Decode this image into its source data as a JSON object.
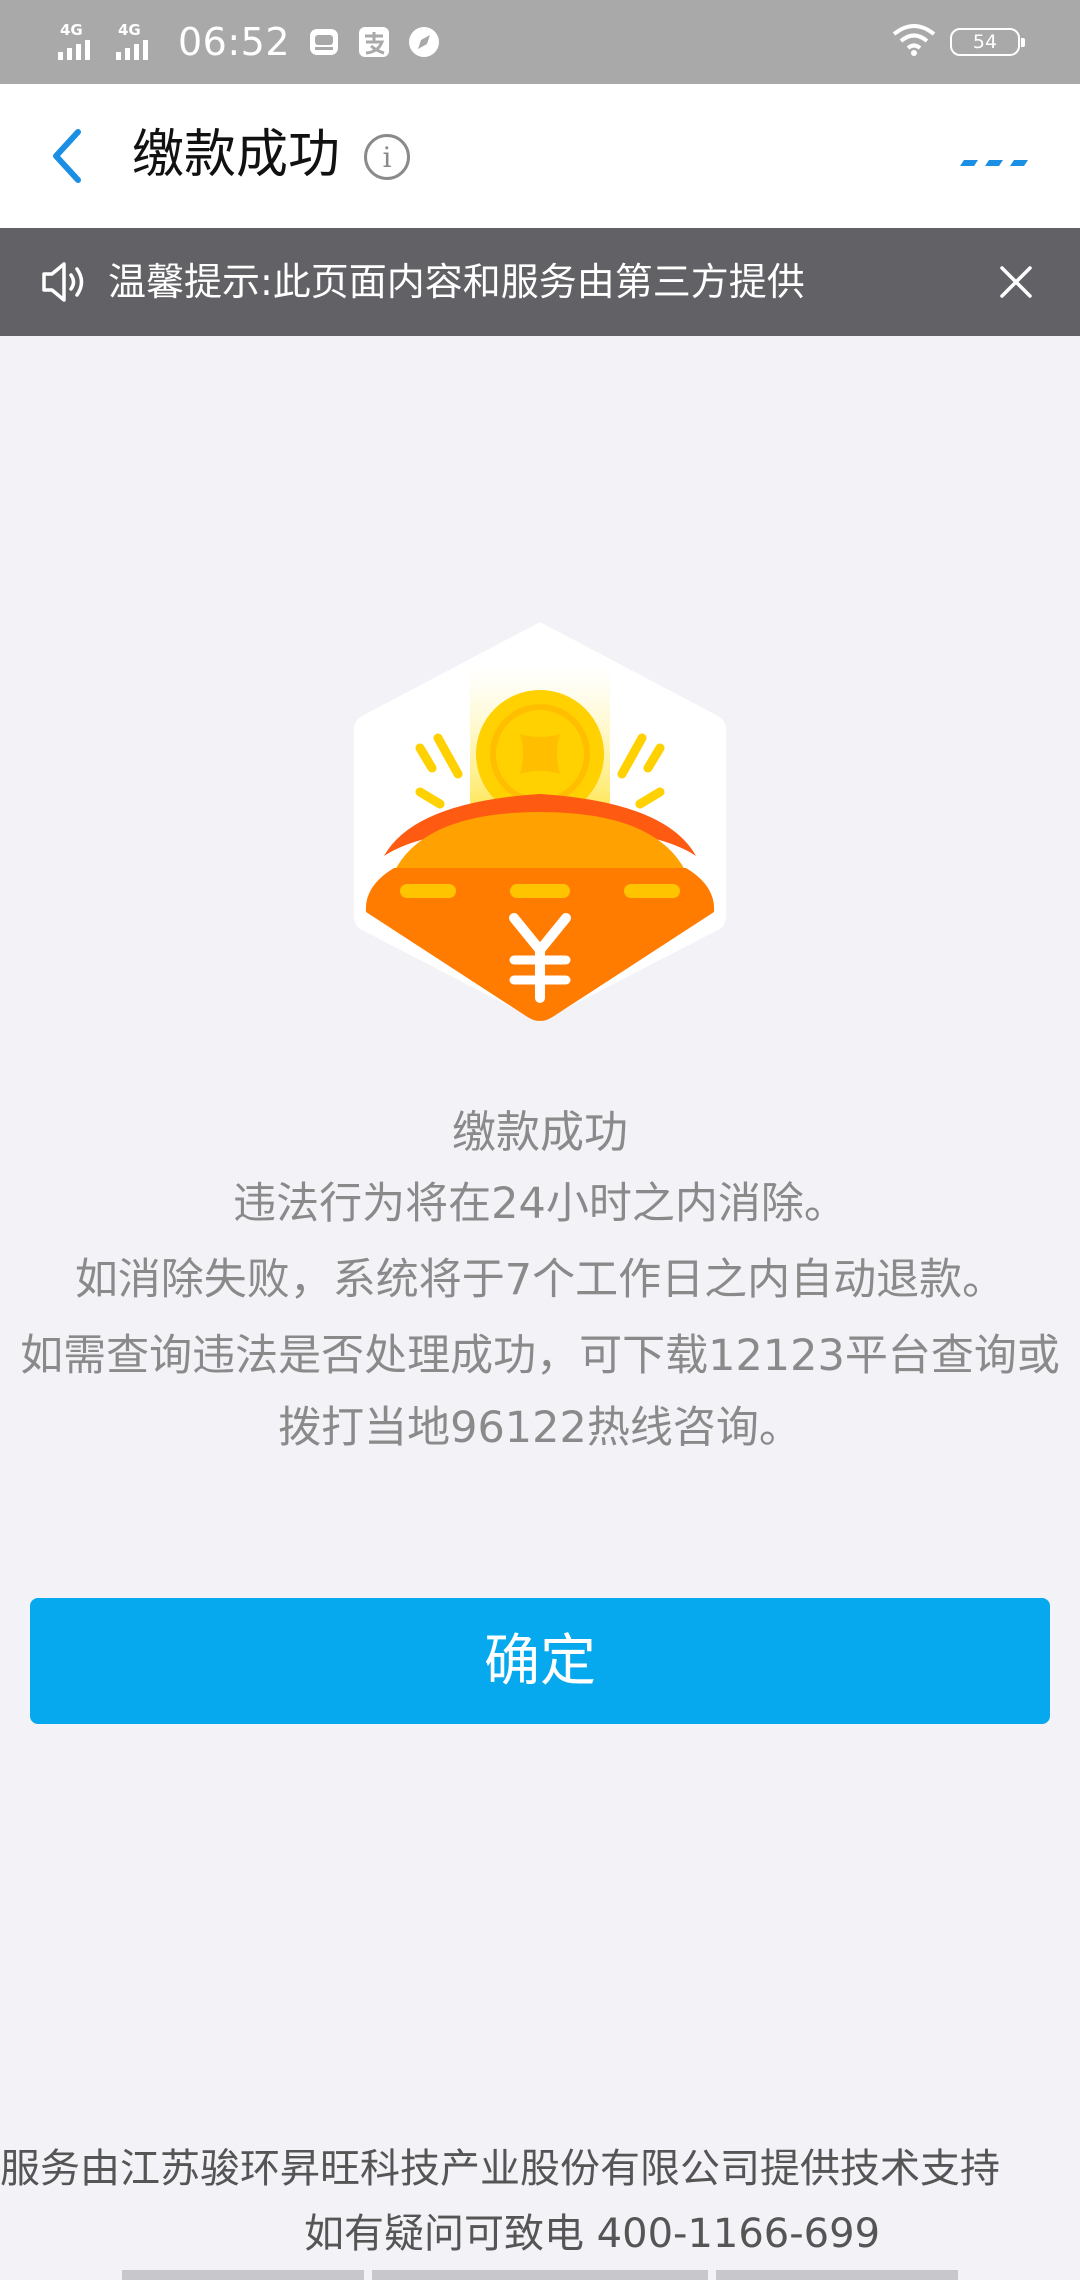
{
  "status_bar": {
    "network_1": "4G",
    "network_2": "4G",
    "time": "06:52",
    "battery": "54"
  },
  "nav": {
    "title": "缴款成功",
    "info_symbol": "i"
  },
  "notice": {
    "text": "温馨提示:此页面内容和服务由第三方提供"
  },
  "message": {
    "title": "缴款成功",
    "line1": "违法行为将在24小时之内消除。",
    "line2": "如消除失败，系统将于7个工作日之内自动退款。",
    "line3": "如需查询违法是否处理成功，可下载12123平台查询或拨打当地96122热线咨询。"
  },
  "actions": {
    "confirm": "确定"
  },
  "footer": {
    "support": "服务由江苏骏环昇旺科技产业股份有限公司提供技术支持",
    "hotline": "如有疑问可致电 400-1166-699"
  },
  "colors": {
    "accent": "#06a9ee",
    "nav_back": "#1a8fe3",
    "notice_bg": "#626266",
    "coin": "#ffd100",
    "bag": "#ff7c00"
  },
  "icons": {
    "back": "chevron-left-icon",
    "info": "info-icon",
    "more": "more-dots-icon",
    "speaker": "speaker-icon",
    "close": "close-icon",
    "illustration": "money-bag-coin-icon"
  }
}
